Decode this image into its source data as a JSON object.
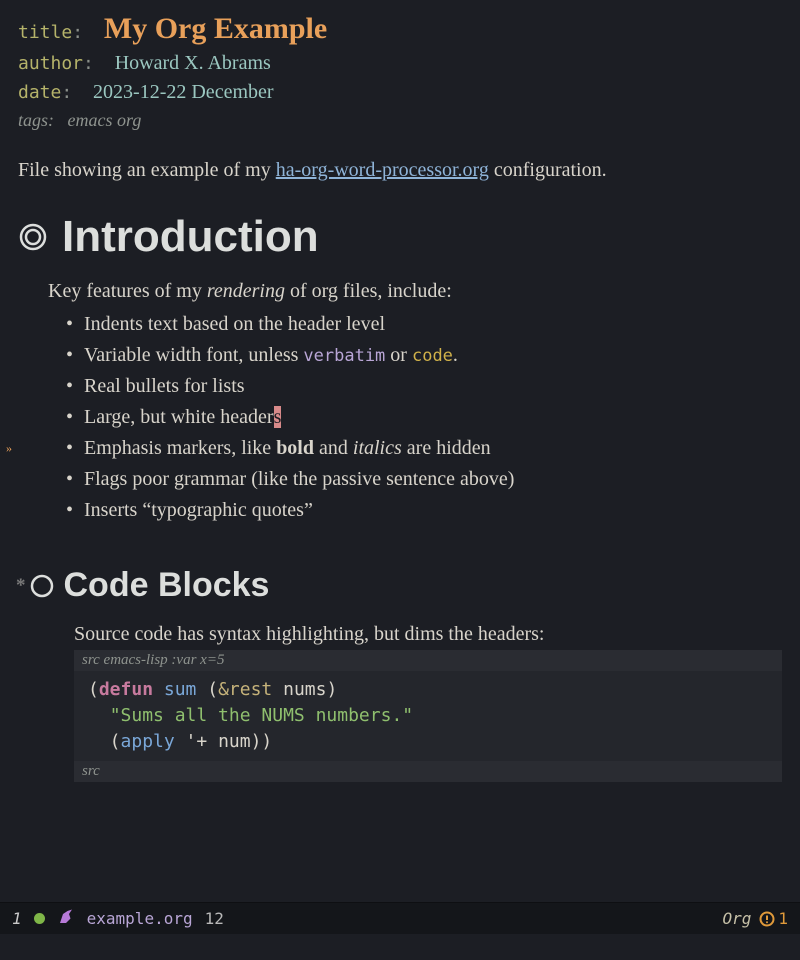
{
  "meta": {
    "title_key": "title",
    "title_val": "My Org Example",
    "author_key": "author",
    "author_val": "Howard X. Abrams",
    "date_key": "date",
    "date_val": "2023-12-22 December",
    "tags_key": "tags:",
    "tags_val": "emacs org"
  },
  "intro_para": {
    "pre": "File showing an example of my ",
    "link": "ha-org-word-processor.org",
    "post": " configuration."
  },
  "headings": {
    "h1": "Introduction",
    "h2_star": "*",
    "h2": "Code Blocks"
  },
  "features": {
    "lead_pre": "Key features of my ",
    "lead_em": "rendering",
    "lead_post": " of org files, include:",
    "items": [
      {
        "text": "Indents text based on the header level"
      },
      {
        "pre": "Variable width font, unless ",
        "verbatim": "verbatim",
        "mid": " or ",
        "code": "code",
        "post": "."
      },
      {
        "text": "Real bullets for lists"
      },
      {
        "pre": "Large, but white header",
        "cursor": "s"
      },
      {
        "pre": "Emphasis markers, like ",
        "bold": "bold",
        "mid": " and ",
        "italic": "italics",
        "post": " are hidden"
      },
      {
        "text": "Flags poor grammar (like the passive sentence above)"
      },
      {
        "text": "Inserts “typographic quotes”"
      }
    ]
  },
  "code": {
    "desc": "Source code has syntax highlighting, but dims the headers:",
    "header_prefix": "src ",
    "header_lang": "emacs-lisp :var x=5",
    "footer": "src",
    "line1": {
      "open": "(",
      "kw": "defun",
      "sp": " ",
      "fn": "sum",
      "sp2": " (",
      "amp": "&rest",
      "sp3": " ",
      "var": "nums",
      "close": ")"
    },
    "line2": {
      "indent": "  ",
      "str": "\"Sums all the NUMS numbers.\""
    },
    "line3": {
      "indent": "  (",
      "fn": "apply",
      "sp": " ",
      "q": "'+",
      "sp2": " ",
      "var": "num",
      "close": "))"
    }
  },
  "modeline": {
    "left_num": "1",
    "filename": "example.org",
    "line": "12",
    "mode": "Org",
    "warn_count": "1"
  }
}
